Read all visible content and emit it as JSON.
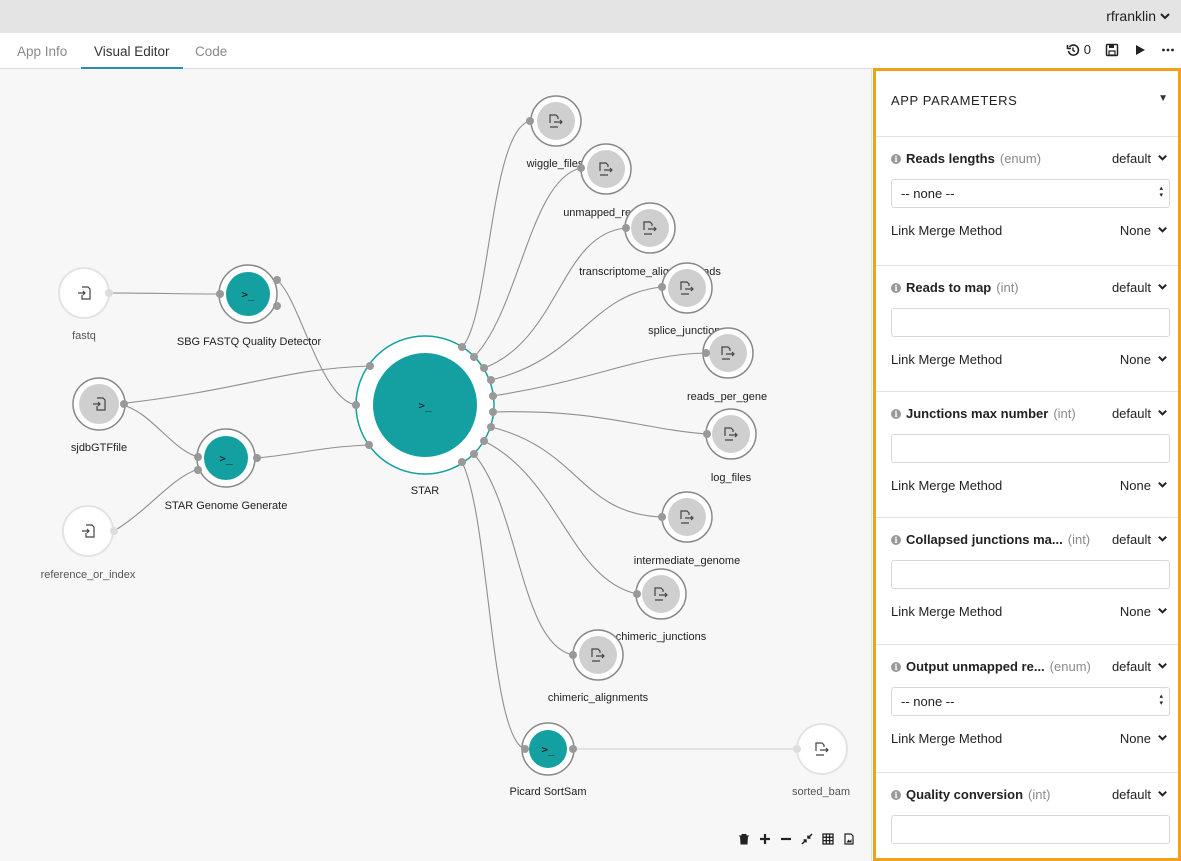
{
  "header": {
    "username": "rfranklin"
  },
  "tabs": [
    {
      "label": "App Info",
      "active": false
    },
    {
      "label": "Visual Editor",
      "active": true
    },
    {
      "label": "Code",
      "active": false
    }
  ],
  "toolbar": {
    "revision_count": "0"
  },
  "graph": {
    "inputs": [
      "fastq",
      "sjdbGTFfile",
      "reference_or_index"
    ],
    "tools": [
      "SBG FASTQ Quality Detector",
      "STAR Genome Generate",
      "STAR",
      "Picard SortSam"
    ],
    "outputs": [
      "wiggle_files",
      "unmapped_reads",
      "transcriptome_aligned_reads",
      "splice_junctions",
      "reads_per_gene",
      "log_files",
      "intermediate_genome",
      "chimeric_junctions",
      "chimeric_alignments",
      "sorted_bam"
    ]
  },
  "panel": {
    "title": "APP PARAMETERS",
    "link_merge_label": "Link Merge Method",
    "params": [
      {
        "name": "Reads lengths",
        "type": "(enum)",
        "default": "default",
        "field": "-- none --",
        "kind": "select",
        "link_merge": "None"
      },
      {
        "name": "Reads to map",
        "type": "(int)",
        "default": "default",
        "field": "",
        "kind": "text",
        "link_merge": "None"
      },
      {
        "name": "Junctions max number",
        "type": "(int)",
        "default": "default",
        "field": "",
        "kind": "text",
        "link_merge": "None"
      },
      {
        "name": "Collapsed junctions ma...",
        "type": "(int)",
        "default": "default",
        "field": "",
        "kind": "text",
        "link_merge": "None"
      },
      {
        "name": "Output unmapped re...",
        "type": "(enum)",
        "default": "default",
        "field": "-- none --",
        "kind": "select",
        "link_merge": "None"
      },
      {
        "name": "Quality conversion",
        "type": "(int)",
        "default": "default",
        "field": "",
        "kind": "text",
        "link_merge": "None"
      }
    ]
  },
  "colors": {
    "accent_tool": "#14a0a0",
    "panel_highlight": "#f0a21c",
    "tab_underline": "#2e8bb6"
  }
}
